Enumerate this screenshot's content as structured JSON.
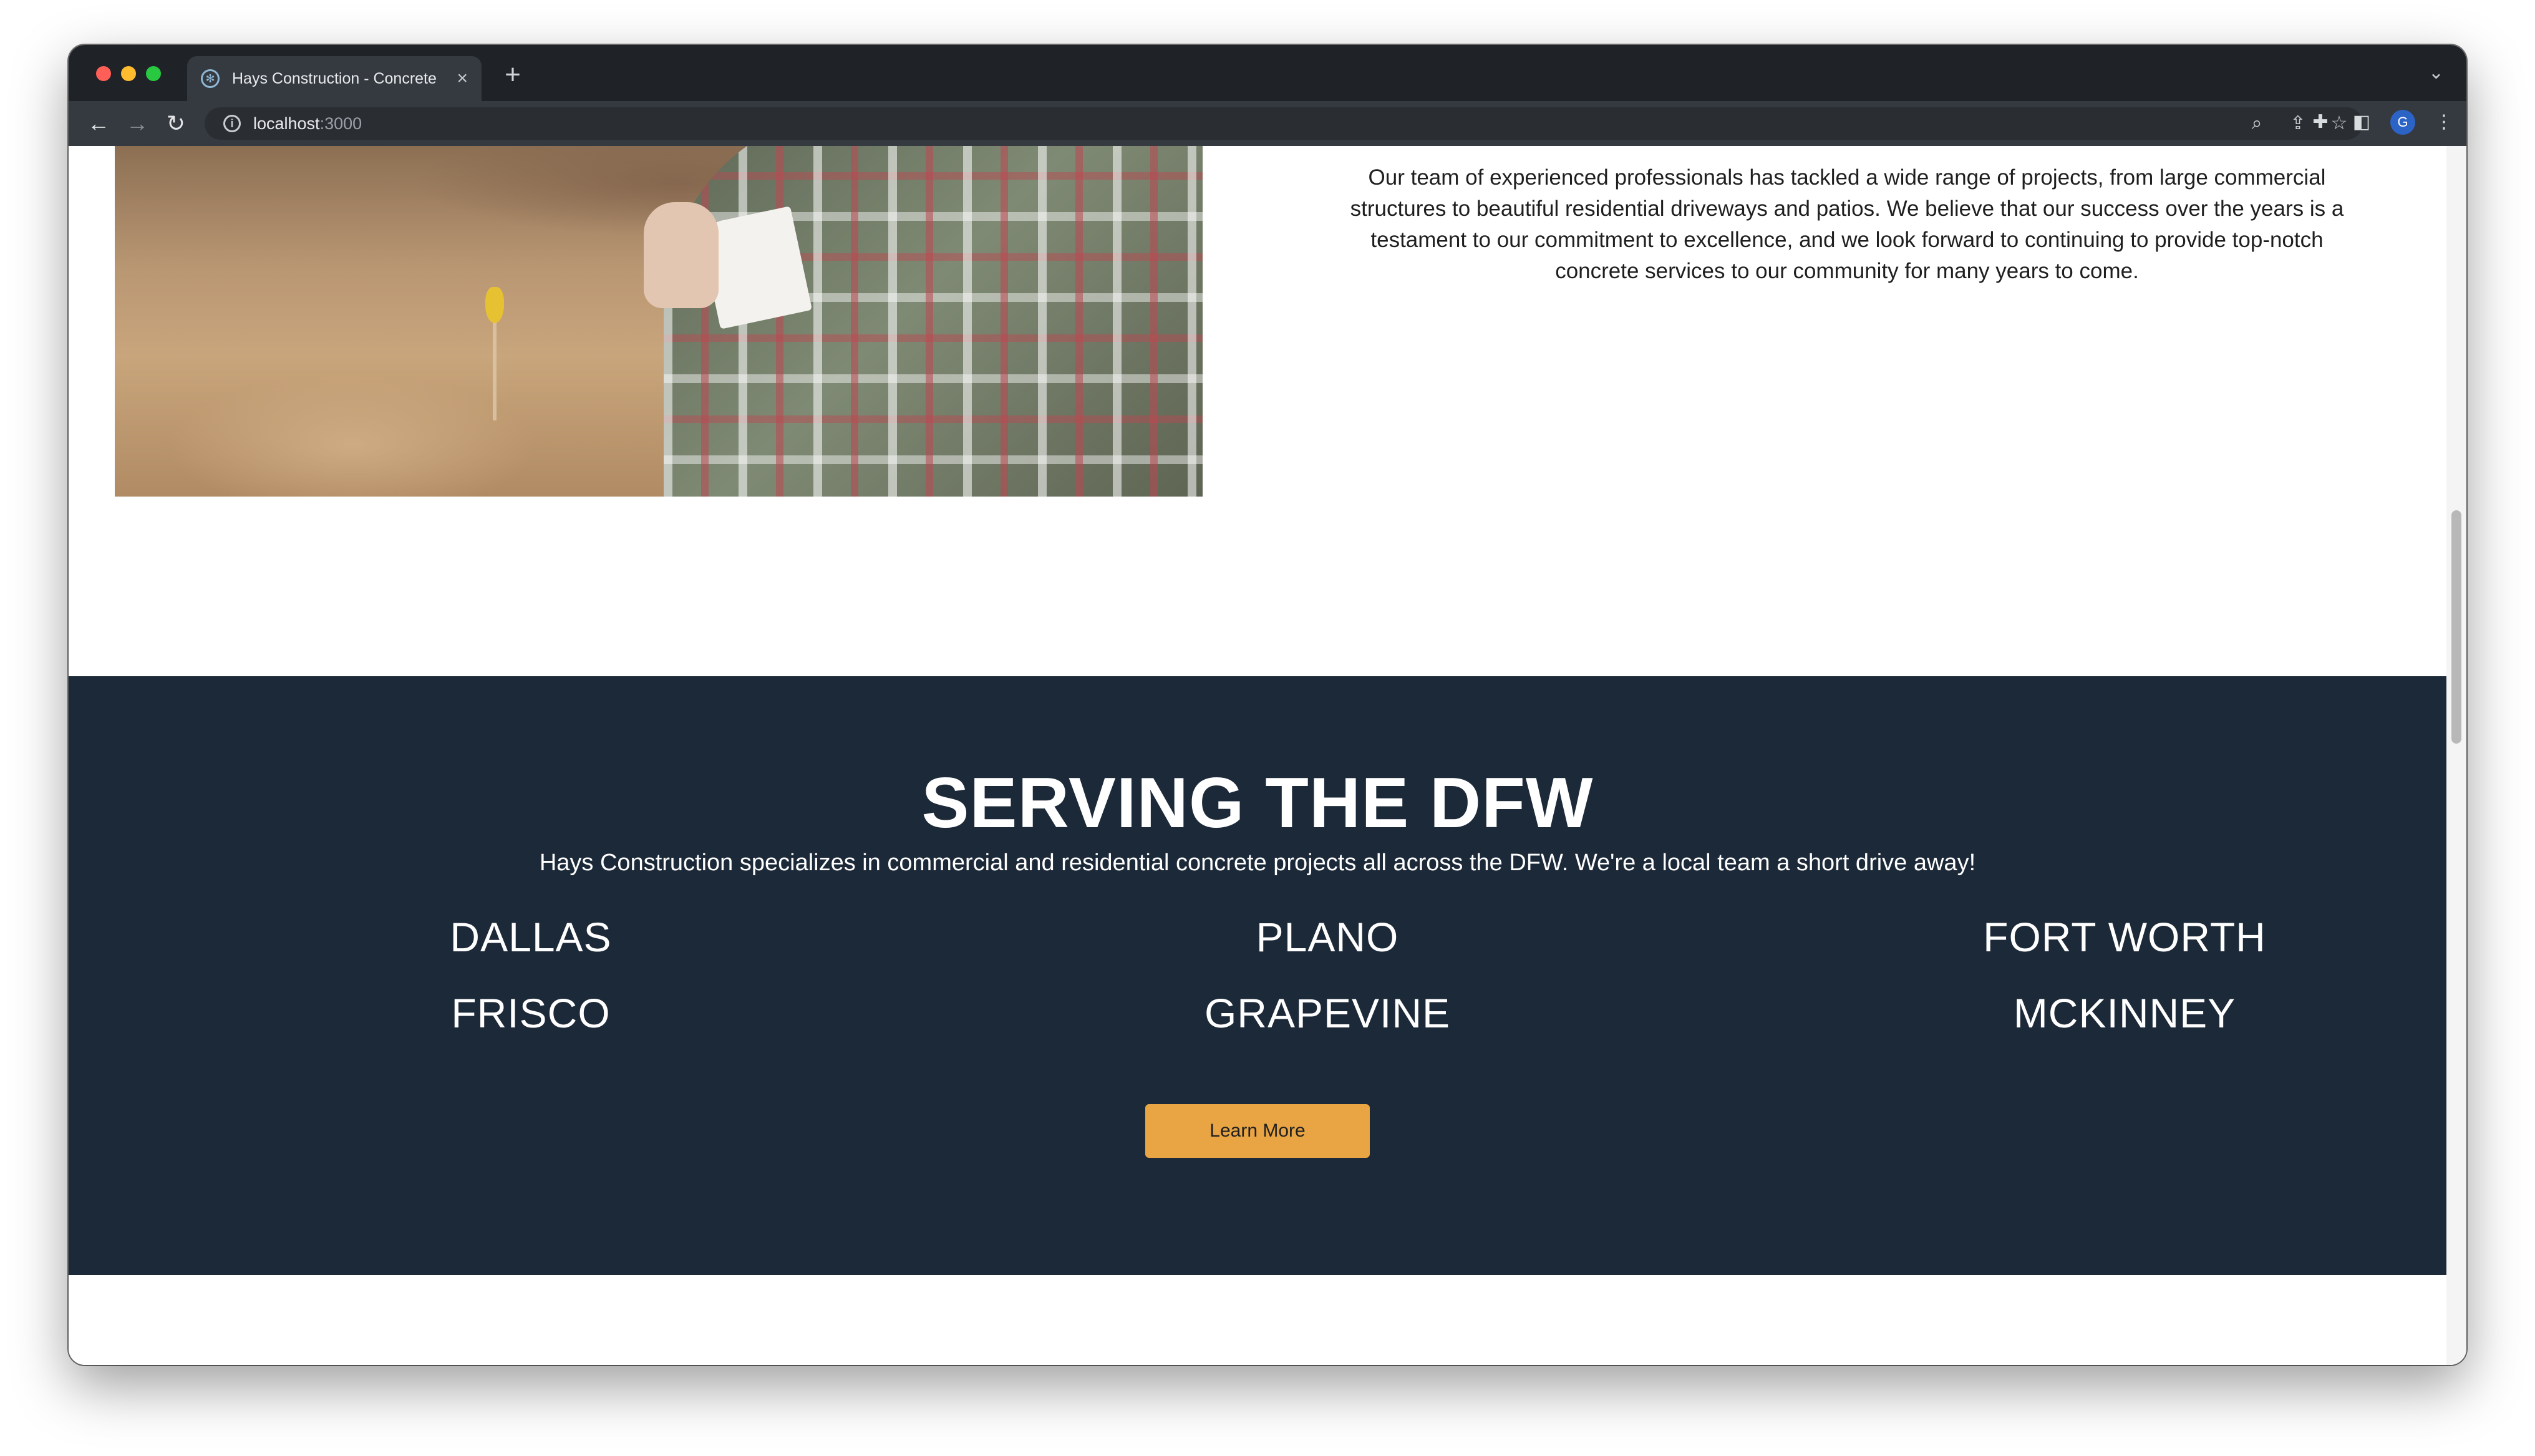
{
  "browser": {
    "tab_title": "Hays Construction - Concrete",
    "url_host": "localhost",
    "url_port": ":3000",
    "avatar_letter": "G"
  },
  "about": {
    "paragraph": "Our team of experienced professionals has tackled a wide range of projects, from large commercial structures to beautiful residential driveways and patios. We believe that our success over the years is a testament to our commitment to excellence, and we look forward to continuing to provide top-notch concrete services to our community for many years to come."
  },
  "service_area": {
    "title": "SERVING THE DFW",
    "description": "Hays Construction specializes in commercial and residential concrete projects all across the DFW. We're a local team a short drive away!",
    "cities": [
      "DALLAS",
      "PLANO",
      "FORT WORTH",
      "FRISCO",
      "GRAPEVINE",
      "MCKINNEY"
    ],
    "button_label": "Learn More"
  },
  "colors": {
    "section_bg": "#1c2938",
    "button_bg": "#e9a544"
  }
}
